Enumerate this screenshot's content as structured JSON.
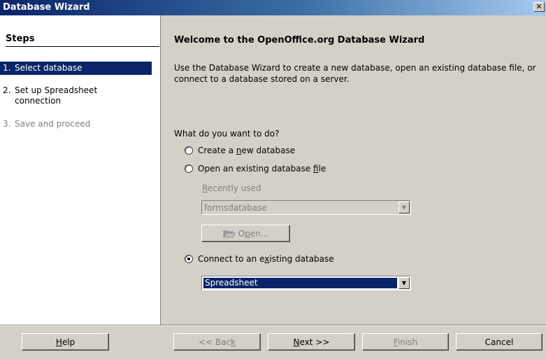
{
  "window": {
    "title": "Database Wizard",
    "close_glyph": "✕"
  },
  "steps": {
    "title": "Steps",
    "items": [
      {
        "num": "1.",
        "label": "Select database",
        "state": "active"
      },
      {
        "num": "2.",
        "label": "Set up Spreadsheet connection",
        "state": "normal"
      },
      {
        "num": "3.",
        "label": "Save and proceed",
        "state": "disabled"
      }
    ]
  },
  "main": {
    "title": "Welcome to the OpenOffice.org Database Wizard",
    "description": "Use the Database Wizard to create a new database, open an existing database file, or connect to a database stored on a server.",
    "question": "What do you want to do?",
    "options": [
      {
        "pre": "Create a ",
        "accel": "n",
        "post": "ew database",
        "checked": false
      },
      {
        "pre": "Open an existing database ",
        "accel": "f",
        "post": "ile",
        "checked": false
      },
      {
        "pre": "Connect to an e",
        "accel": "x",
        "post": "isting database",
        "checked": true
      }
    ],
    "recently_used": {
      "accel": "R",
      "rest": "ecently used"
    },
    "recent_file": "formsdatabase",
    "open_button": {
      "pre": "O",
      "accel": "p",
      "post": "en..."
    },
    "db_type": "Spreadsheet"
  },
  "buttons": {
    "help": {
      "pre": "",
      "accel": "H",
      "post": "elp"
    },
    "back": {
      "pre": "<< Bac",
      "accel": "k",
      "post": ""
    },
    "next": {
      "pre": "",
      "accel": "N",
      "post": "ext >>"
    },
    "finish": {
      "pre": "",
      "accel": "F",
      "post": "inish"
    },
    "cancel": "Cancel"
  }
}
